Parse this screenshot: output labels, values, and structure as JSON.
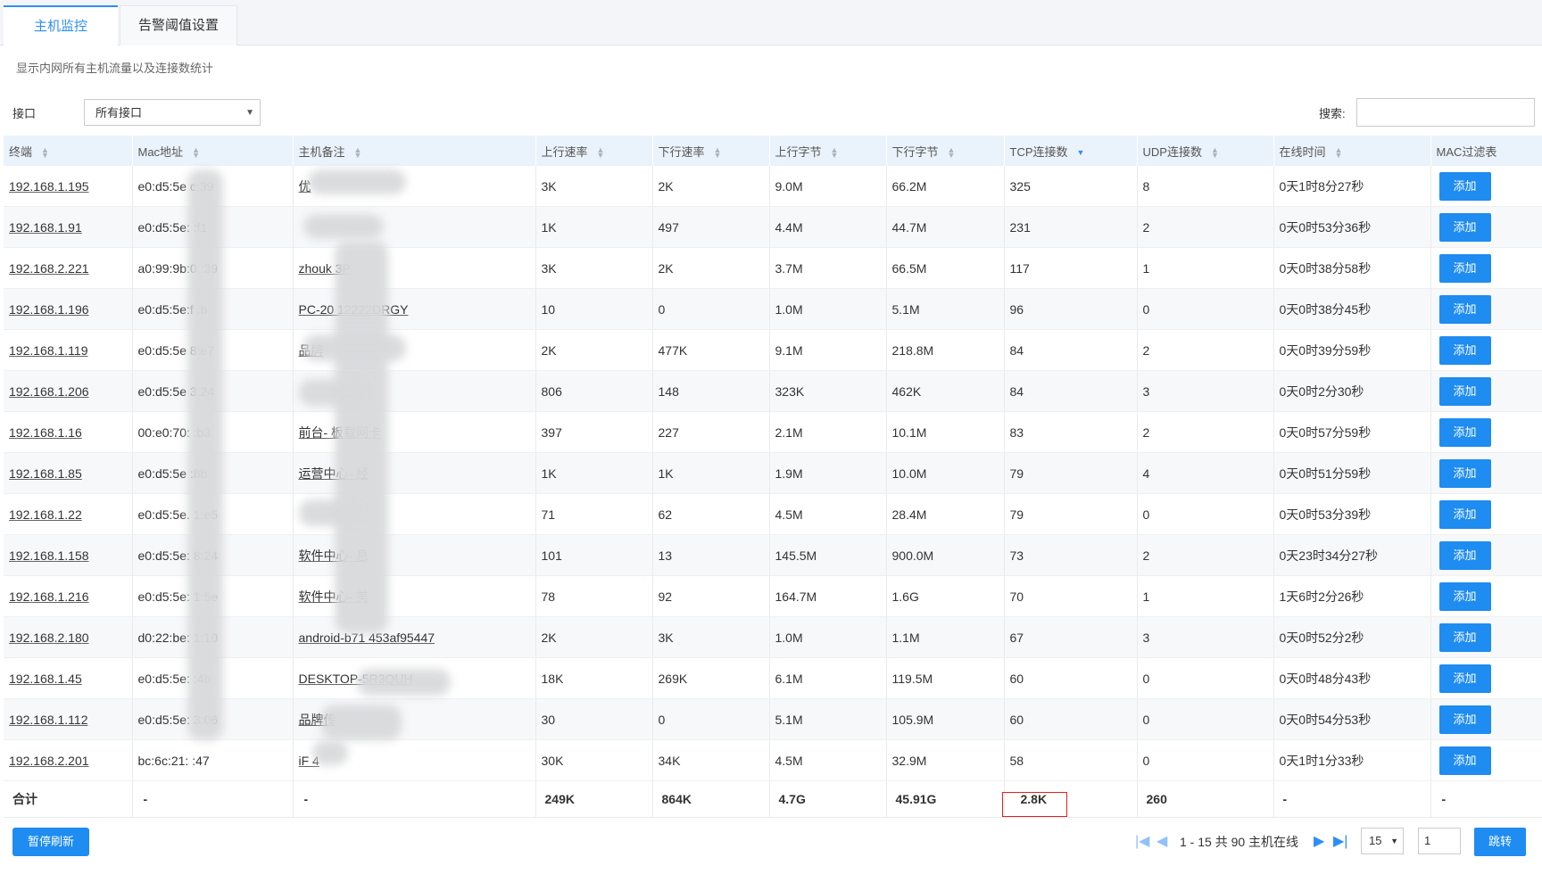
{
  "tabs": [
    {
      "label": "主机监控",
      "active": true
    },
    {
      "label": "告警阈值设置",
      "active": false
    }
  ],
  "subtitle": "显示内网所有主机流量以及连接数统计",
  "filters": {
    "interface_label": "接口",
    "interface_value": "所有接口",
    "search_label": "搜索:",
    "search_value": ""
  },
  "columns": [
    "终端",
    "Mac地址",
    "主机备注",
    "上行速率",
    "下行速率",
    "上行字节",
    "下行字节",
    "TCP连接数",
    "UDP连接数",
    "在线时间",
    "MAC过滤表"
  ],
  "rows": [
    {
      "ip": "192.168.1.195",
      "mac": "e0:d5:5e c:39",
      "note": "优",
      "up_rate": "3K",
      "down_rate": "2K",
      "up_bytes": "9.0M",
      "down_bytes": "66.2M",
      "tcp": "325",
      "udp": "8",
      "online": "0天1时8分27秒"
    },
    {
      "ip": "192.168.1.91",
      "mac": "e0:d5:5e: :f1",
      "note": "",
      "up_rate": "1K",
      "down_rate": "497",
      "up_bytes": "4.4M",
      "down_bytes": "44.7M",
      "tcp": "231",
      "udp": "2",
      "online": "0天0时53分36秒"
    },
    {
      "ip": "192.168.2.221",
      "mac": "a0:99:9b:0 :39",
      "note": "zhouk 3P",
      "up_rate": "3K",
      "down_rate": "2K",
      "up_bytes": "3.7M",
      "down_bytes": "66.5M",
      "tcp": "117",
      "udp": "1",
      "online": "0天0时38分58秒"
    },
    {
      "ip": "192.168.1.196",
      "mac": "e0:d5:5e:f .b",
      "note": "PC-20 12222DRGY",
      "up_rate": "10",
      "down_rate": "0",
      "up_bytes": "1.0M",
      "down_bytes": "5.1M",
      "tcp": "96",
      "udp": "0",
      "online": "0天0时38分45秒"
    },
    {
      "ip": "192.168.1.119",
      "mac": "e0:d5:5e 8:e7",
      "note": "品牌",
      "up_rate": "2K",
      "down_rate": "477K",
      "up_bytes": "9.1M",
      "down_bytes": "218.8M",
      "tcp": "84",
      "udp": "2",
      "online": "0天0时39分59秒"
    },
    {
      "ip": "192.168.1.206",
      "mac": "e0:d5:5e 3:24",
      "note": "",
      "up_rate": "806",
      "down_rate": "148",
      "up_bytes": "323K",
      "down_bytes": "462K",
      "tcp": "84",
      "udp": "3",
      "online": "0天0时2分30秒"
    },
    {
      "ip": "192.168.1.16",
      "mac": "00:e0:70: :b3",
      "note": "前台- 板载网卡",
      "up_rate": "397",
      "down_rate": "227",
      "up_bytes": "2.1M",
      "down_bytes": "10.1M",
      "tcp": "83",
      "udp": "2",
      "online": "0天0时57分59秒"
    },
    {
      "ip": "192.168.1.85",
      "mac": "e0:d5:5e :8b",
      "note": "运营中心- 经",
      "up_rate": "1K",
      "down_rate": "1K",
      "up_bytes": "1.9M",
      "down_bytes": "10.0M",
      "tcp": "79",
      "udp": "4",
      "online": "0天0时51分59秒"
    },
    {
      "ip": "192.168.1.22",
      "mac": "e0:d5:5e. 1:e5",
      "note": "",
      "up_rate": "71",
      "down_rate": "62",
      "up_bytes": "4.5M",
      "down_bytes": "28.4M",
      "tcp": "79",
      "udp": "0",
      "online": "0天0时53分39秒"
    },
    {
      "ip": "192.168.1.158",
      "mac": "e0:d5:5e: 8:24",
      "note": "软件中心- 息",
      "up_rate": "101",
      "down_rate": "13",
      "up_bytes": "145.5M",
      "down_bytes": "900.0M",
      "tcp": "73",
      "udp": "2",
      "online": "0天23时34分27秒"
    },
    {
      "ip": "192.168.1.216",
      "mac": "e0:d5:5e: 1:5e",
      "note": "软件中心- 美",
      "up_rate": "78",
      "down_rate": "92",
      "up_bytes": "164.7M",
      "down_bytes": "1.6G",
      "tcp": "70",
      "udp": "1",
      "online": "1天6时2分26秒"
    },
    {
      "ip": "192.168.2.180",
      "mac": "d0:22:be: 1:10",
      "note": "android-b71 453af95447",
      "up_rate": "2K",
      "down_rate": "3K",
      "up_bytes": "1.0M",
      "down_bytes": "1.1M",
      "tcp": "67",
      "udp": "3",
      "online": "0天0时52分2秒"
    },
    {
      "ip": "192.168.1.45",
      "mac": "e0:d5:5e: :4b",
      "note": "DESKTOP-5R3QUH",
      "up_rate": "18K",
      "down_rate": "269K",
      "up_bytes": "6.1M",
      "down_bytes": "119.5M",
      "tcp": "60",
      "udp": "0",
      "online": "0天0时48分43秒"
    },
    {
      "ip": "192.168.1.112",
      "mac": "e0:d5:5e: 3:06",
      "note": "品牌传",
      "up_rate": "30",
      "down_rate": "0",
      "up_bytes": "5.1M",
      "down_bytes": "105.9M",
      "tcp": "60",
      "udp": "0",
      "online": "0天0时54分53秒"
    },
    {
      "ip": "192.168.2.201",
      "mac": "bc:6c:21: :47",
      "note": "iF 4",
      "up_rate": "30K",
      "down_rate": "34K",
      "up_bytes": "4.5M",
      "down_bytes": "32.9M",
      "tcp": "58",
      "udp": "0",
      "online": "0天1时1分33秒"
    }
  ],
  "add_label": "添加",
  "total": {
    "label": "合计",
    "mac": "-",
    "note": "-",
    "up_rate": "249K",
    "down_rate": "864K",
    "up_bytes": "4.7G",
    "down_bytes": "45.91G",
    "tcp": "2.8K",
    "udp": "260",
    "online": "-",
    "mac_filter": "-"
  },
  "footer": {
    "pause_label": "暂停刷新",
    "page_info": "1 - 15 共 90 主机在线",
    "page_size": "15",
    "page_number": "1",
    "jump_label": "跳转"
  },
  "colors": {
    "accent": "#1e8cf0",
    "header_bg": "#eaf3fb",
    "highlight": "#e02020"
  }
}
